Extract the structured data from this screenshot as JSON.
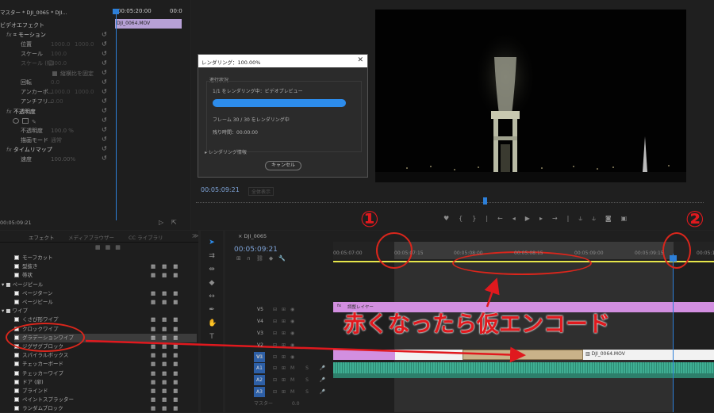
{
  "effect_controls": {
    "tab_master": "マスター * DJI_0065 * DJI...",
    "timecode_top": "00:05:20:00",
    "timecode_top_right": "00:0",
    "clip_label": "DJI_0064.MOV",
    "video_effects": "ビデオエフェクト",
    "motion": "モーション",
    "position": "位置",
    "position_x": "1000.0",
    "position_y": "1000.0",
    "scale": "スケール",
    "scale_value": "100.0",
    "scale_w": "スケール (幅)",
    "scale_w_value": "100.0",
    "uniform_scale": "縦横比を固定",
    "rotation": "回転",
    "rotation_value": "0.0",
    "anchor": "アンカーポ...",
    "anchor_x": "1000.0",
    "anchor_y": "1000.0",
    "antiflicker": "アンチフリ...",
    "antiflicker_value": "0.00",
    "opacity_group": "不透明度",
    "opacity": "不透明度",
    "opacity_value": "100.0 %",
    "blend_mode": "描画モード",
    "blend_value": "通常",
    "time_remap": "タイムリマップ",
    "speed": "速度",
    "speed_value": "100.00%",
    "bottom_timecode": "00:05:09:21"
  },
  "dialog": {
    "title": "レンダリング：100.00%",
    "progress_section": "進行状況",
    "line1": "1/1 をレンダリング中：ビデオプレビュー",
    "progress": 1.0,
    "line2": "フレーム 30 / 30 をレンダリング中",
    "line3": "残り時間：00:00:00",
    "details": "レンダリング情報",
    "cancel": "キャンセル",
    "close": "✕"
  },
  "program": {
    "timecode": "00:05:09:21",
    "fit": "全体表示"
  },
  "effects_panel": {
    "tabs": [
      "エフェクト",
      "メディアブラウザー",
      "CC ライブラリ"
    ],
    "items": [
      {
        "label": "モーフカット",
        "type": "item"
      },
      {
        "label": "型抜き",
        "type": "item"
      },
      {
        "label": "帯状",
        "type": "item"
      },
      {
        "label": "ページピール",
        "type": "folder"
      },
      {
        "label": "ページターン",
        "type": "item"
      },
      {
        "label": "ページピール",
        "type": "item"
      },
      {
        "label": "ワイプ",
        "type": "folder"
      },
      {
        "label": "くさび形ワイプ",
        "type": "item"
      },
      {
        "label": "クロックワイプ",
        "type": "item"
      },
      {
        "label": "グラデーションワイプ",
        "type": "item"
      },
      {
        "label": "ジグザグブロック",
        "type": "item"
      },
      {
        "label": "スパイラルボックス",
        "type": "item"
      },
      {
        "label": "チェッカーボード",
        "type": "item"
      },
      {
        "label": "チェッカーワイプ",
        "type": "item"
      },
      {
        "label": "ドア (扉)",
        "type": "item"
      },
      {
        "label": "ブラインド",
        "type": "item"
      },
      {
        "label": "ペイントスプラッター",
        "type": "item"
      },
      {
        "label": "ランダムブロック",
        "type": "item"
      }
    ]
  },
  "timeline": {
    "tab": "DJI_0065",
    "timecode": "00:05:09:21",
    "ruler": [
      "00:05:07:00",
      "00:05:07:15",
      "00:05:08:00",
      "00:05:08:15",
      "00:05:09:00",
      "00:05:09:15",
      "00:05:10"
    ],
    "tracks_video": [
      "V5",
      "V4",
      "V3",
      "V2",
      "V1"
    ],
    "tracks_audio": [
      "A1",
      "A2",
      "A3"
    ],
    "master": "マスター",
    "master_value": "0.0",
    "adjust_layer": "調整レイヤー",
    "clip_name": "DJI_0064.MOV",
    "source_v1": "V1",
    "source_a1": "A1"
  },
  "annotations": {
    "marker1": "①",
    "marker2": "②",
    "caption": "赤くなったら仮エンコード"
  },
  "colors": {
    "accent": "#2d8ceb",
    "red": "#e0191e",
    "adjust": "#d28fe0",
    "yellow": "#e6e64a",
    "audio": "#3fae93"
  }
}
